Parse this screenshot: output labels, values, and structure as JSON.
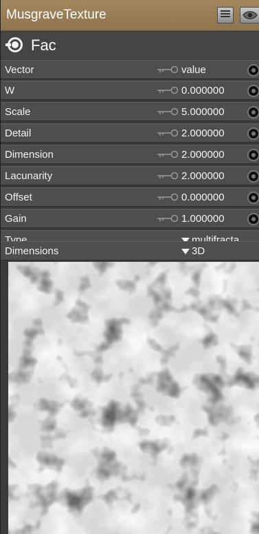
{
  "node": {
    "title": "MusgraveTexture",
    "header_color": "#9b7f58",
    "output": {
      "label": "Fac"
    },
    "inputs": [
      {
        "label": "Vector",
        "value": "value",
        "kind": "socket"
      },
      {
        "label": "W",
        "value": "0.000000",
        "kind": "socket"
      },
      {
        "label": "Scale",
        "value": "5.000000",
        "kind": "socket"
      },
      {
        "label": "Detail",
        "value": "2.000000",
        "kind": "socket"
      },
      {
        "label": "Dimension",
        "value": "2.000000",
        "kind": "socket"
      },
      {
        "label": "Lacunarity",
        "value": "2.000000",
        "kind": "socket"
      },
      {
        "label": "Offset",
        "value": "0.000000",
        "kind": "socket"
      },
      {
        "label": "Gain",
        "value": "1.000000",
        "kind": "socket"
      }
    ],
    "dropdowns": [
      {
        "label": "Type",
        "value": "multifracta"
      },
      {
        "label": "Dimensions",
        "value": "3D"
      }
    ],
    "icons": [
      "menu-icon",
      "eye-icon",
      "output-socket-icon",
      "key-icon",
      "input-socket-icon",
      "dropdown-arrow-icon"
    ]
  }
}
